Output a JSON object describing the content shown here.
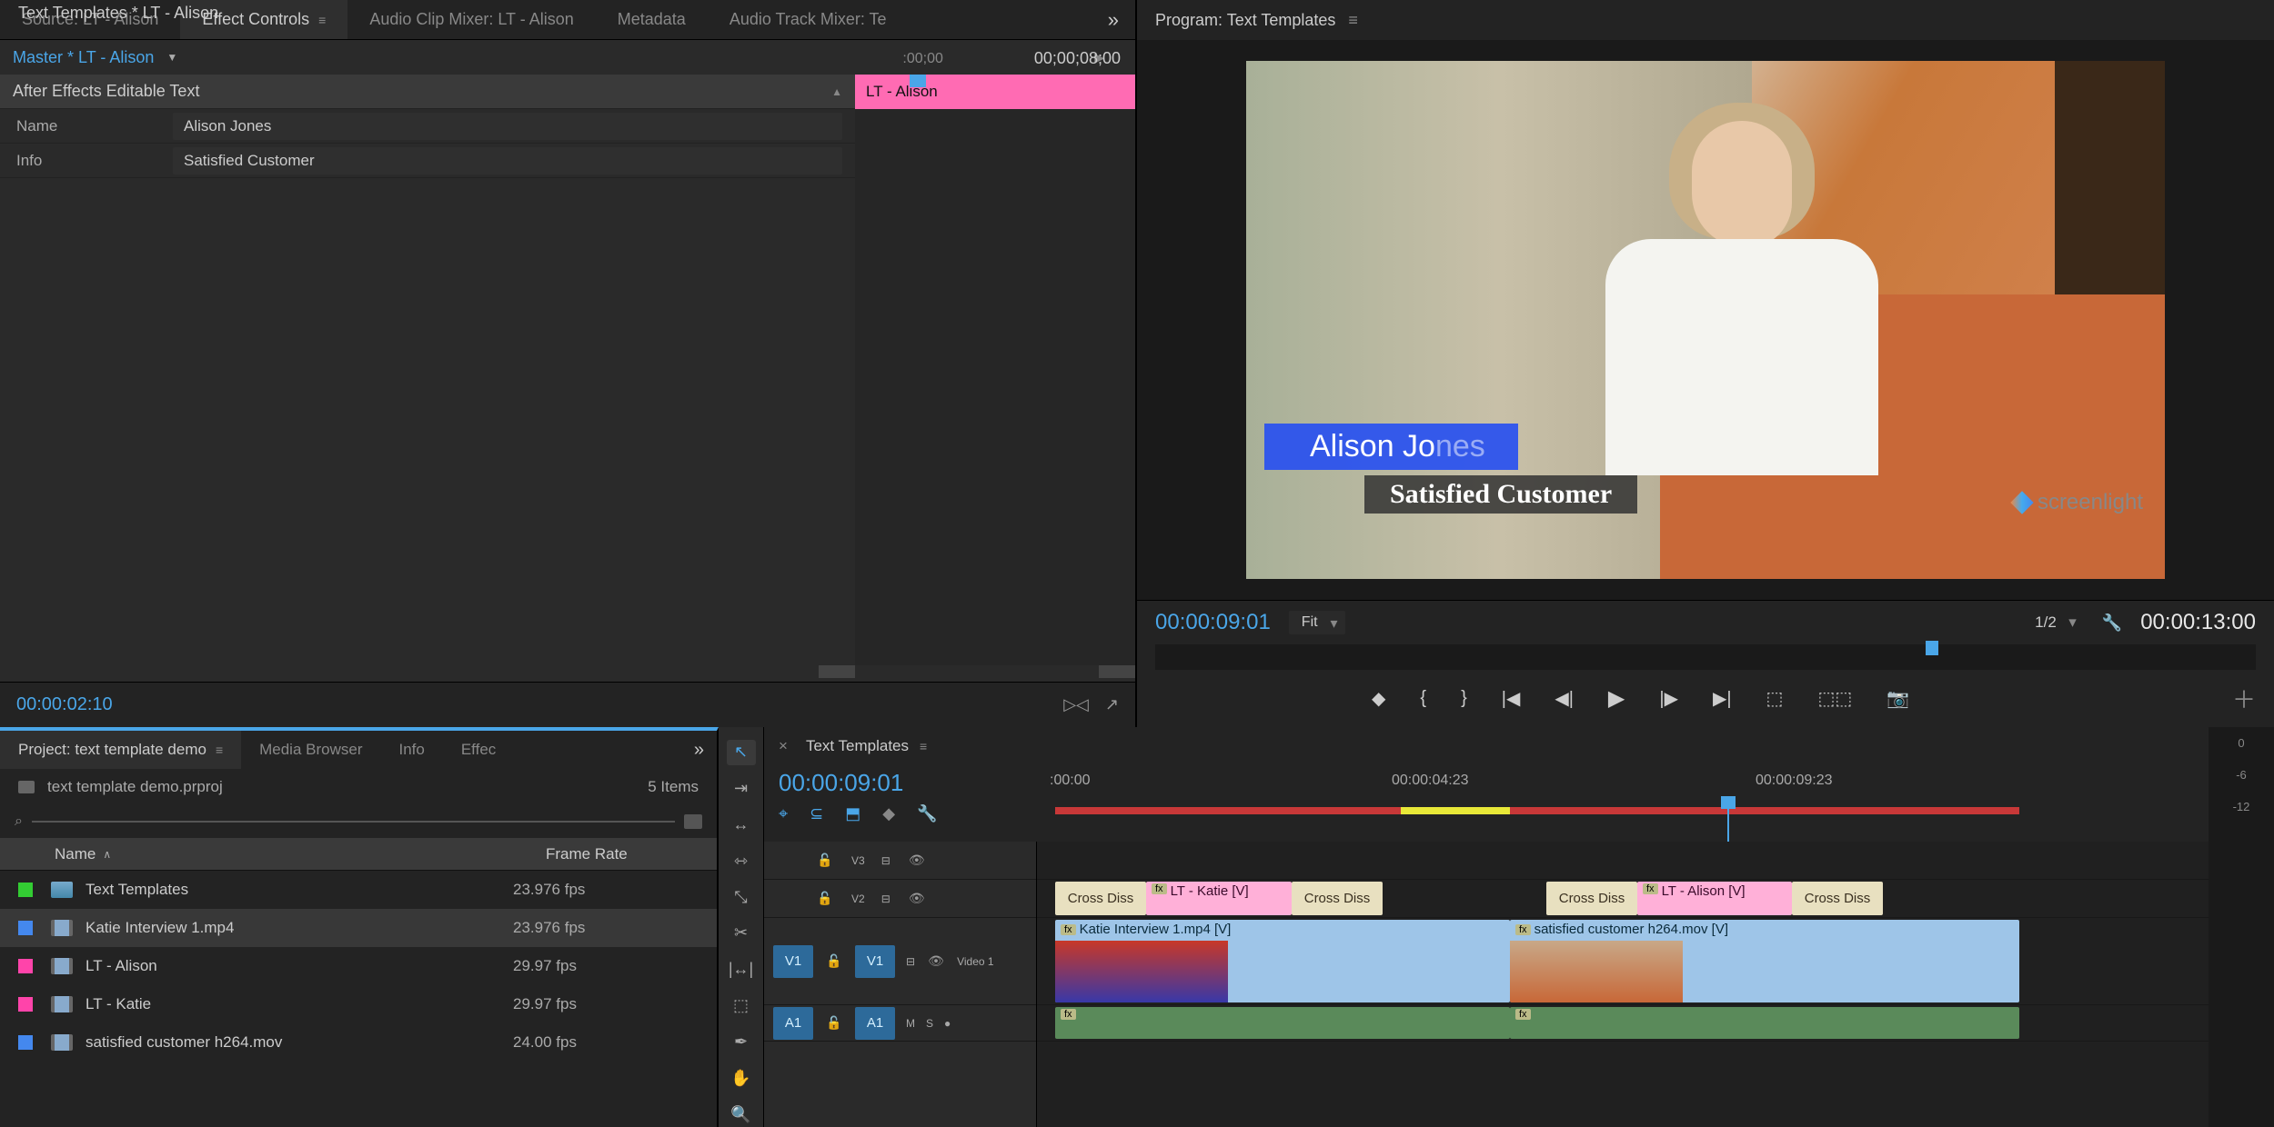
{
  "sourceTabs": {
    "source": "Source: LT - Alison",
    "effectControls": "Effect Controls",
    "audioClipMixer": "Audio Clip Mixer: LT - Alison",
    "metadata": "Metadata",
    "audioTrackMixer": "Audio Track Mixer: Te"
  },
  "effectControls": {
    "master": "Master * LT - Alison",
    "clip": "Text Templates * LT - Alison",
    "tcStart": ":00;00",
    "tcEnd": "00;00;08;00",
    "section": "After Effects Editable Text",
    "clipBar": "LT - Alison",
    "rows": {
      "nameLabel": "Name",
      "nameValue": "Alison Jones",
      "infoLabel": "Info",
      "infoValue": "Satisfied Customer"
    },
    "footerTc": "00:00:02:10"
  },
  "programTab": "Program: Text Templates",
  "programViewer": {
    "lowerThirdNameA": "Alison Jo",
    "lowerThirdNameB": "nes",
    "lowerThirdSub": "Satisfied Customer",
    "watermark": "screenlight"
  },
  "programCtrl": {
    "tcLeft": "00:00:09:01",
    "fit": "Fit",
    "scale": "1/2",
    "tcRight": "00:00:13:00"
  },
  "projectTabs": {
    "project": "Project: text template demo",
    "mediaBrowser": "Media Browser",
    "info": "Info",
    "effects": "Effec"
  },
  "project": {
    "filepath": "text template demo.prproj",
    "count": "5 Items",
    "headerName": "Name",
    "headerFrameRate": "Frame Rate",
    "items": [
      {
        "swatch": "sw-green",
        "name": "Text Templates",
        "fr": "23.976 fps"
      },
      {
        "swatch": "sw-blue",
        "name": "Katie Interview 1.mp4",
        "fr": "23.976 fps"
      },
      {
        "swatch": "sw-pink",
        "name": "LT - Alison",
        "fr": "29.97 fps"
      },
      {
        "swatch": "sw-pink",
        "name": "LT - Katie",
        "fr": "29.97 fps"
      },
      {
        "swatch": "sw-blue",
        "name": "satisfied customer h264.mov",
        "fr": "24.00 fps"
      }
    ]
  },
  "timeline": {
    "tab": "Text Templates",
    "tc": "00:00:09:01",
    "rulerLabels": [
      ":00:00",
      "00:00:04:23",
      "00:00:09:23"
    ],
    "tracks": {
      "v3": "V3",
      "v2": "V2",
      "v1": "V1",
      "video1": "Video 1",
      "a1": "A1"
    },
    "clips": {
      "ltKatie": "LT - Katie [V]",
      "ltAlison": "LT - Alison [V]",
      "crossDiss": "Cross Diss",
      "katieInt": "Katie Interview 1.mp4 [V]",
      "satCust": "satisfied customer h264.mov [V]"
    }
  },
  "meterLabels": [
    "0",
    "-6",
    "-12"
  ]
}
